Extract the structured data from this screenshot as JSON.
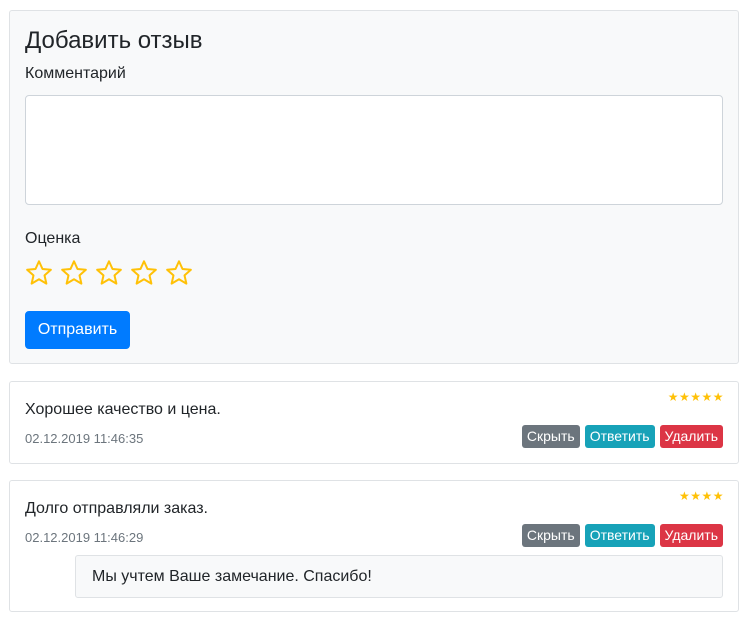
{
  "form": {
    "title": "Добавить отзыв",
    "comment_label": "Комментарий",
    "comment_value": "",
    "rating_label": "Оценка",
    "rating_value": 0,
    "rating_max": 5,
    "submit_label": "Отправить"
  },
  "reviews": [
    {
      "rating": 5,
      "stars": "★★★★★",
      "text": "Хорошее качество и цена.",
      "date": "02.12.2019 11:46:35",
      "hide_label": "Скрыть",
      "reply_label": "Ответить",
      "delete_label": "Удалить",
      "reply": null
    },
    {
      "rating": 4,
      "stars": "★★★★",
      "text": "Долго отправляли заказ.",
      "date": "02.12.2019 11:46:29",
      "hide_label": "Скрыть",
      "reply_label": "Ответить",
      "delete_label": "Удалить",
      "reply": "Мы учтем Ваше замечание. Спасибо!"
    }
  ],
  "colors": {
    "primary": "#007bff",
    "secondary": "#6c757d",
    "info": "#17a2b8",
    "danger": "#dc3545",
    "star": "#ffc107"
  },
  "icons": {
    "rating_star": "star-outline-icon",
    "review_star": "star-filled-icon"
  }
}
